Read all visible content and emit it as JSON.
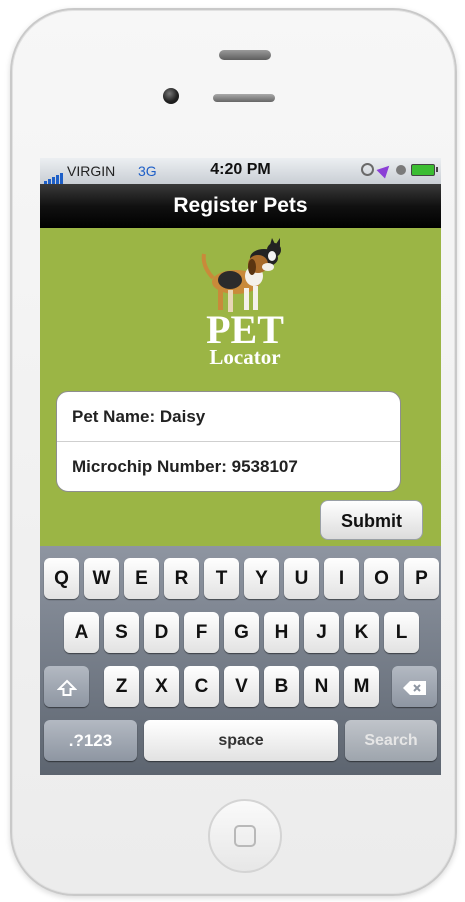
{
  "status": {
    "carrier": "VIRGIN",
    "network": "3G",
    "time": "4:20 PM"
  },
  "nav": {
    "title": "Register Pets"
  },
  "logo": {
    "line1": "PET",
    "line2": "Locator"
  },
  "form": {
    "pet_name": "Pet Name: Daisy",
    "microchip": "Microchip Number: 9538107"
  },
  "submit": {
    "label": "Submit"
  },
  "keyboard": {
    "row1": [
      "Q",
      "W",
      "E",
      "R",
      "T",
      "Y",
      "U",
      "I",
      "O",
      "P"
    ],
    "row2": [
      "A",
      "S",
      "D",
      "F",
      "G",
      "H",
      "J",
      "K",
      "L"
    ],
    "row3": [
      "Z",
      "X",
      "C",
      "V",
      "B",
      "N",
      "M"
    ],
    "numbers_label": ".?123",
    "space_label": "space",
    "search_label": "Search"
  },
  "colors": {
    "background_green": "#9bb545",
    "navbar_black": "#111111",
    "network_blue": "#1e5fc7"
  },
  "icons": [
    "signal-icon",
    "rotation-lock-icon",
    "location-arrow-icon",
    "alarm-icon",
    "battery-icon",
    "shift-icon",
    "backspace-icon"
  ]
}
